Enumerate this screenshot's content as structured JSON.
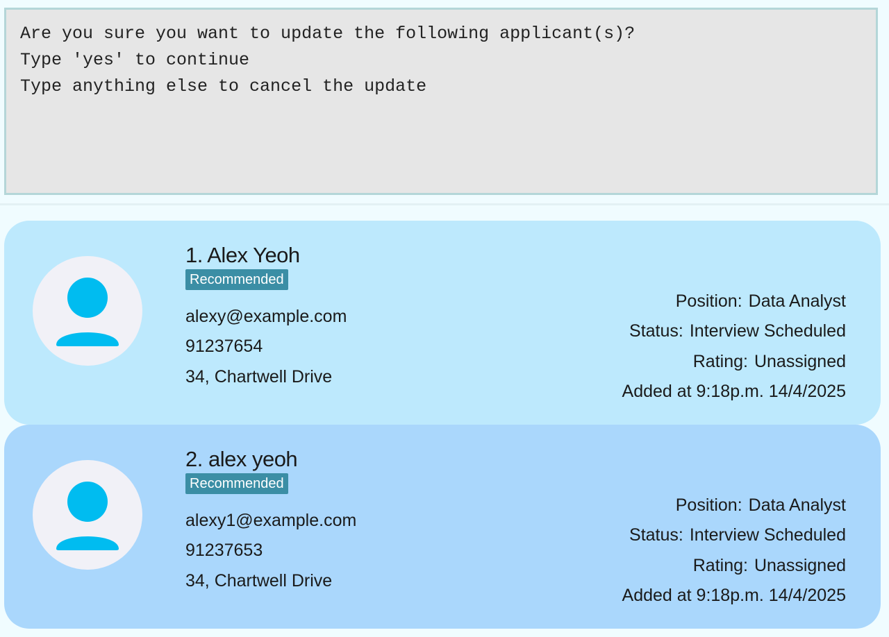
{
  "command_result": {
    "lines": [
      "Are you sure you want to update the following applicant(s)?",
      "Type 'yes' to continue",
      "Type anything else to cancel the update"
    ]
  },
  "applicants": [
    {
      "name": "1. Alex Yeoh",
      "tag": "Recommended",
      "email": "alexy@example.com",
      "phone": "91237654",
      "address": "34, Chartwell Drive",
      "position_label": "Position:",
      "position": "Data Analyst",
      "status_label": "Status:",
      "status": "Interview Scheduled",
      "rating_label": "Rating:",
      "rating": "Unassigned",
      "added": "Added at 9:18p.m. 14/4/2025"
    },
    {
      "name": "2. alex yeoh",
      "tag": "Recommended",
      "email": "alexy1@example.com",
      "phone": "91237653",
      "address": "34, Chartwell Drive",
      "position_label": "Position:",
      "position": "Data Analyst",
      "status_label": "Status:",
      "status": "Interview Scheduled",
      "rating_label": "Rating:",
      "rating": "Unassigned",
      "added": "Added at 9:18p.m. 14/4/2025"
    }
  ],
  "colors": {
    "card_1_bg": "#bde9fd",
    "card_2_bg": "#aad7fc",
    "tag_bg": "#3b8ea5",
    "avatar_icon": "#00bcf0"
  },
  "icons": {
    "avatar": "user-icon"
  }
}
